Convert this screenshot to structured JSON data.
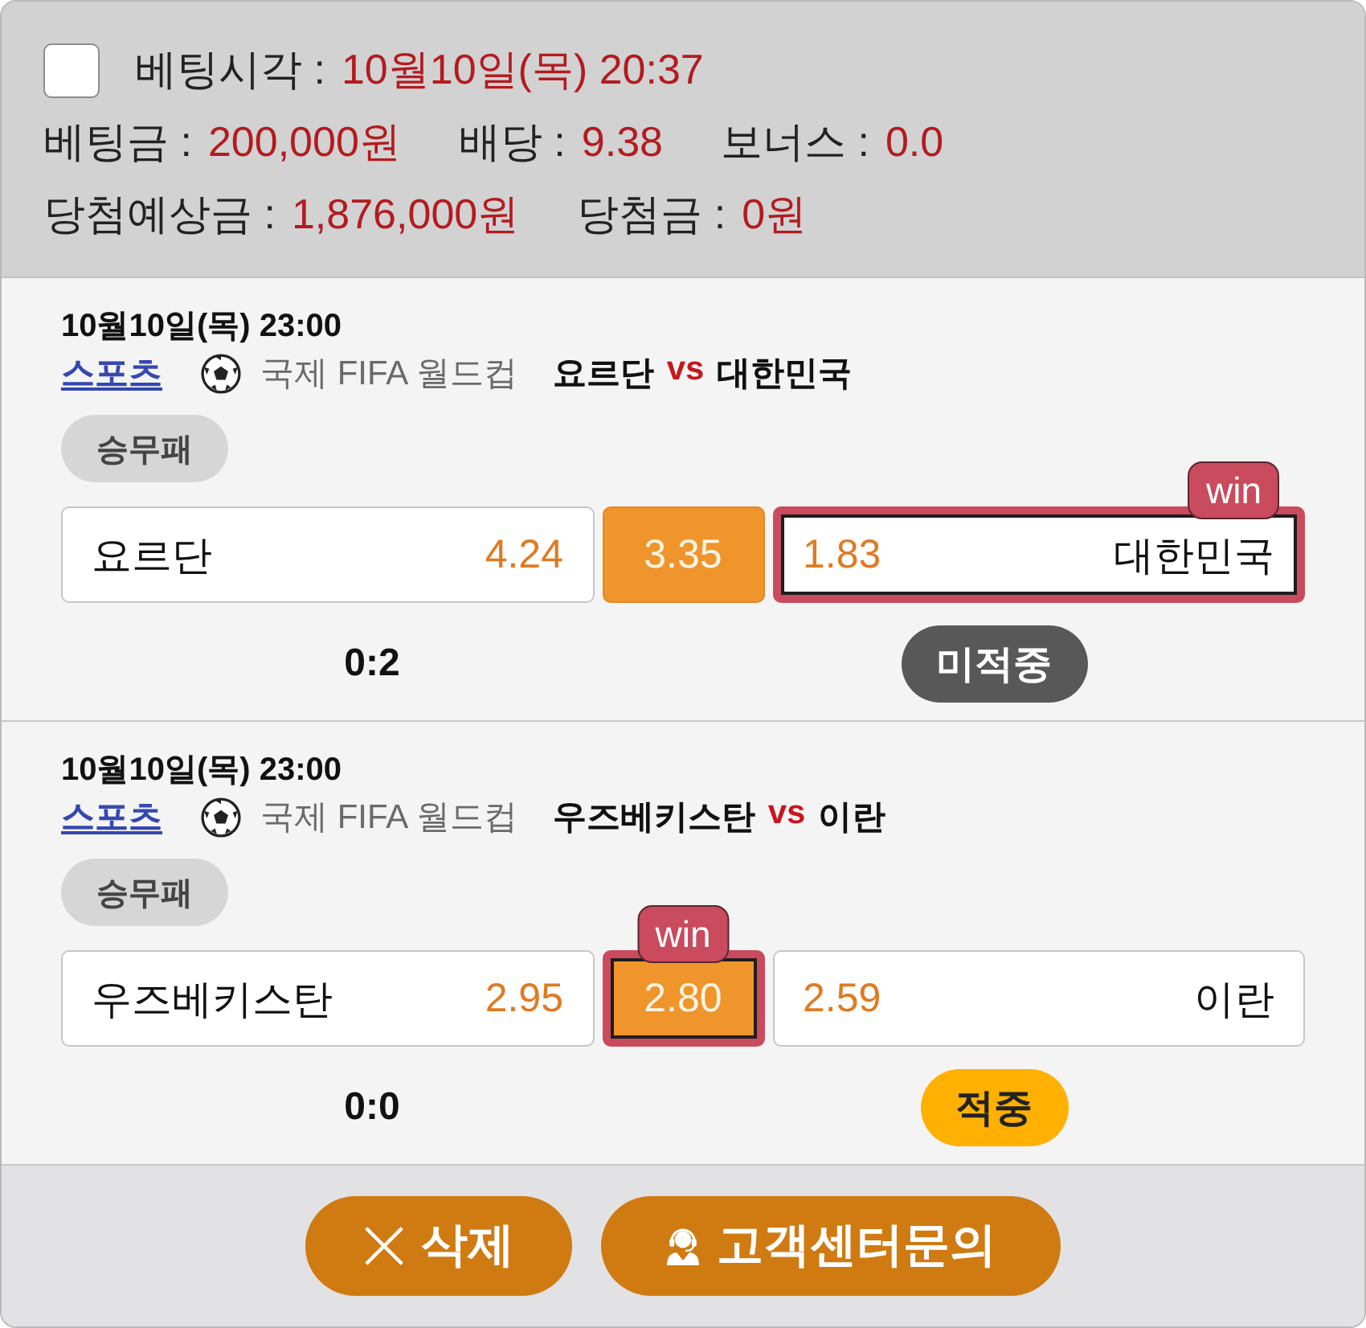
{
  "summary": {
    "checked": false,
    "rows": [
      [
        {
          "label": "베팅시각 :",
          "value": "10월10일(목) 20:37"
        }
      ],
      [
        {
          "label": "베팅금 :",
          "value": "200,000원"
        },
        {
          "label": "배당 :",
          "value": "9.38"
        },
        {
          "label": "보너스 :",
          "value": "0.0"
        }
      ],
      [
        {
          "label": "당첨예상금 :",
          "value": "1,876,000원"
        },
        {
          "label": "당첨금 :",
          "value": "0원"
        }
      ]
    ]
  },
  "bets": [
    {
      "date": "10월10일(목) 23:00",
      "category": "스포츠",
      "league": "국제 FIFA 월드컵",
      "home": "요르단",
      "vs": "vs",
      "away": "대한민국",
      "market": "승무패",
      "options": [
        {
          "kind": "home",
          "label": "요르단",
          "odds": "4.24",
          "selected": false
        },
        {
          "kind": "draw",
          "odds": "3.35",
          "selected": false
        },
        {
          "kind": "away",
          "label": "대한민국",
          "odds": "1.83",
          "selected": true,
          "badge": "win"
        }
      ],
      "score": "0:2",
      "result": {
        "kind": "miss",
        "label": "미적중"
      }
    },
    {
      "date": "10월10일(목) 23:00",
      "category": "스포츠",
      "league": "국제 FIFA 월드컵",
      "home": "우즈베키스탄",
      "vs": "vs",
      "away": "이란",
      "market": "승무패",
      "options": [
        {
          "kind": "home",
          "label": "우즈베키스탄",
          "odds": "2.95",
          "selected": false
        },
        {
          "kind": "draw",
          "odds": "2.80",
          "selected": true,
          "badge": "win"
        },
        {
          "kind": "away",
          "label": "이란",
          "odds": "2.59",
          "selected": false
        }
      ],
      "score": "0:0",
      "result": {
        "kind": "hit",
        "label": "적중"
      }
    }
  ],
  "buttons": [
    {
      "kind": "delete",
      "label": "삭제"
    },
    {
      "kind": "support",
      "label": "고객센터문의"
    }
  ]
}
